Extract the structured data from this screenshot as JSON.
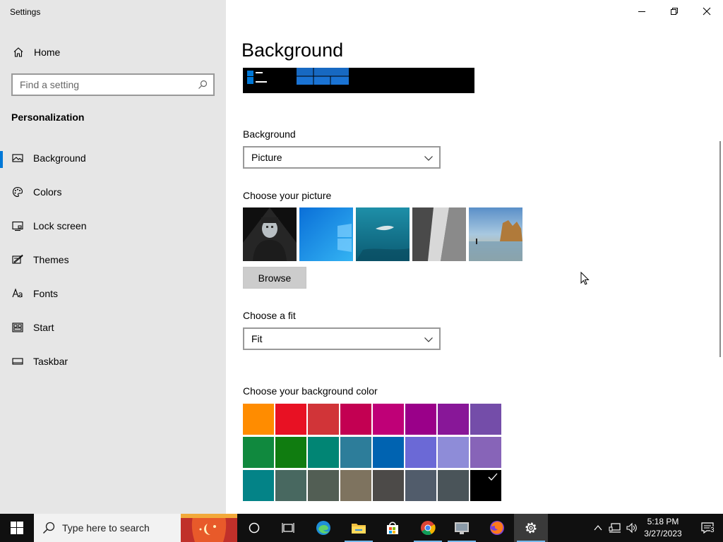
{
  "window": {
    "app_title": "Settings"
  },
  "sidebar": {
    "home_label": "Home",
    "search_placeholder": "Find a setting",
    "section_heading": "Personalization",
    "items": [
      {
        "label": "Background",
        "icon": "picture-icon",
        "active": true
      },
      {
        "label": "Colors",
        "icon": "palette-icon",
        "active": false
      },
      {
        "label": "Lock screen",
        "icon": "lock-screen-icon",
        "active": false
      },
      {
        "label": "Themes",
        "icon": "themes-icon",
        "active": false
      },
      {
        "label": "Fonts",
        "icon": "fonts-icon",
        "active": false
      },
      {
        "label": "Start",
        "icon": "start-icon",
        "active": false
      },
      {
        "label": "Taskbar",
        "icon": "taskbar-icon",
        "active": false
      }
    ]
  },
  "main": {
    "page_title": "Background",
    "background_label": "Background",
    "background_value": "Picture",
    "choose_picture_label": "Choose your picture",
    "browse_label": "Browse",
    "choose_fit_label": "Choose a fit",
    "fit_value": "Fit",
    "choose_color_label": "Choose your background color",
    "swatch_colors": [
      "#ff8c00",
      "#e81123",
      "#d13438",
      "#c30052",
      "#bf0077",
      "#9a0089",
      "#881798",
      "#744da9",
      "#10893e",
      "#107c10",
      "#018574",
      "#2d7d9a",
      "#0063b1",
      "#6b69d6",
      "#8e8cd8",
      "#8764b8",
      "#038387",
      "#486860",
      "#525e54",
      "#7e735f",
      "#4c4a48",
      "#515c6b",
      "#4a5459",
      "#000000"
    ],
    "selected_swatch_index": 23
  },
  "taskbar": {
    "search_placeholder": "Type here to search",
    "time": "5:18 PM",
    "date": "3/27/2023",
    "notification_count": "3"
  },
  "colors": {
    "accent": "#0078d7",
    "sidebar_bg": "#e6e6e6",
    "taskbar_bg": "#101010"
  }
}
